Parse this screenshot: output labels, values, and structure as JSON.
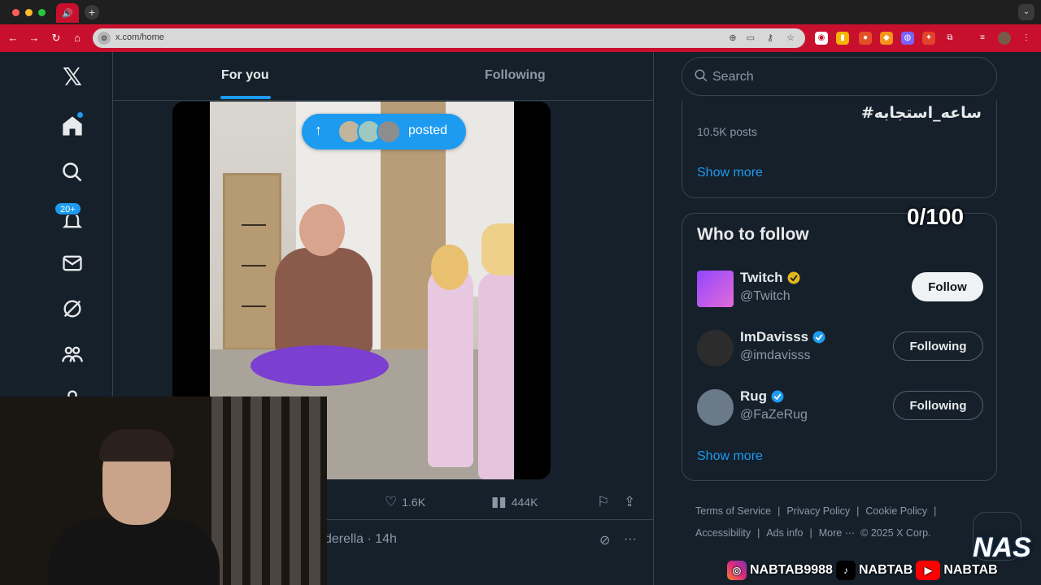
{
  "browser": {
    "url": "x.com/home"
  },
  "timeline": {
    "tabs": [
      {
        "label": "For you"
      },
      {
        "label": "Following"
      }
    ],
    "posted_label": "posted",
    "actions": {
      "likes": "1.6K",
      "views": "444K"
    },
    "next_post_name": "derella · 14h"
  },
  "sidebar": {
    "notifications_badge": "20+"
  },
  "search": {
    "placeholder": "Search"
  },
  "trend": {
    "hashtag": "#ساعه_استجابه",
    "posts": "10.5K posts",
    "show_more": "Show more"
  },
  "who_to_follow": {
    "title": "Who to follow",
    "counter": "0/100",
    "users": [
      {
        "name": "Twitch",
        "handle": "@Twitch",
        "button": "Follow",
        "verified": "gold"
      },
      {
        "name": "ImDavisss",
        "handle": "@imdavisss",
        "button": "Following",
        "verified": "blue"
      },
      {
        "name": "Rug",
        "handle": "@FaZeRug",
        "button": "Following",
        "verified": "blue"
      }
    ],
    "show_more": "Show more"
  },
  "footer": {
    "links": [
      "Terms of Service",
      "Privacy Policy",
      "Cookie Policy",
      "Accessibility",
      "Ads info",
      "More ···"
    ],
    "copyright": "© 2025 X Corp."
  },
  "overlay": {
    "instagram": "NABTAB9988",
    "tiktok": "NABTAB",
    "youtube": "NABTAB",
    "logo": "NAS"
  },
  "colors": {
    "accent": "#1d9bf0",
    "background": "#15202b",
    "border": "#38444d",
    "browser_toolbar": "#c8102e"
  }
}
